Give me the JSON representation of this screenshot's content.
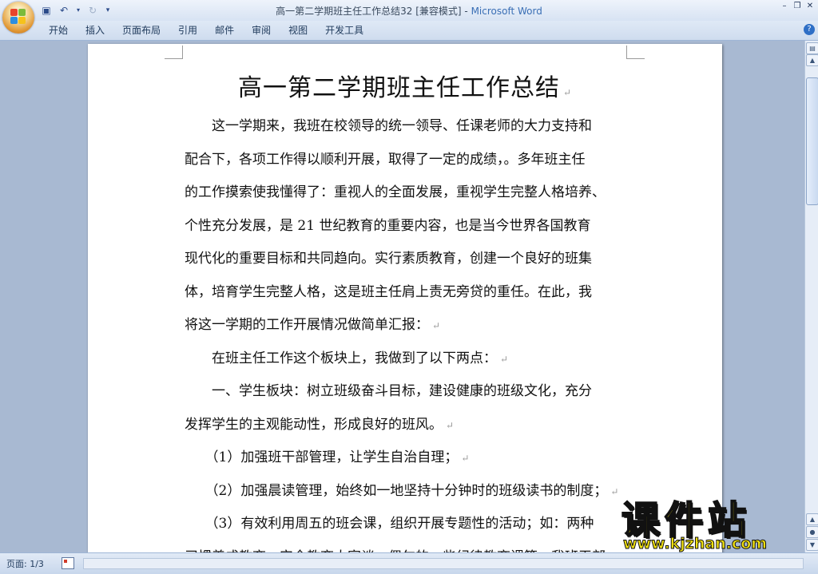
{
  "window": {
    "title": "高一第二学期班主任工作总结32 [兼容模式] - ",
    "app_name": "Microsoft Word",
    "help_label": "?"
  },
  "ribbon": {
    "tabs": [
      "开始",
      "插入",
      "页面布局",
      "引用",
      "邮件",
      "审阅",
      "视图",
      "开发工具"
    ]
  },
  "document": {
    "title": "高一第二学期班主任工作总结",
    "lines": [
      "　　这一学期来，我班在校领导的统一领导、任课老师的大力支持和",
      "配合下，各项工作得以顺利开展，取得了一定的成绩，。多年班主任",
      "的工作摸索使我懂得了：重视人的全面发展，重视学生完整人格培养、",
      "个性充分发展，是 21 世纪教育的重要内容，也是当今世界各国教育",
      "现代化的重要目标和共同趋向。实行素质教育，创建一个良好的班集",
      "体，培育学生完整人格，这是班主任肩上责无旁贷的重任。在此，我",
      "将这一学期的工作开展情况做简单汇报：",
      "　　在班主任工作这个板块上，我做到了以下两点：",
      "　　一、学生板块：树立班级奋斗目标，建设健康的班级文化，充分",
      "发挥学生的主观能动性，形成良好的班风。",
      "　　（1）加强班干部管理，让学生自治自理；",
      "　　（2）加强晨读管理，始终如一地坚持十分钟时的班级读书的制度；",
      "　　（3）有效利用周五的班会课，组织开展专题性的活动；如：两种",
      "习惯养成教育、安全教育大家谈、偶尔的一些纪律教育课等，我班干部"
    ],
    "para_mark": "↵"
  },
  "status": {
    "page": "页面: 1/3"
  },
  "watermark": {
    "title": "课件站",
    "url": "www.kjzhan.com"
  }
}
